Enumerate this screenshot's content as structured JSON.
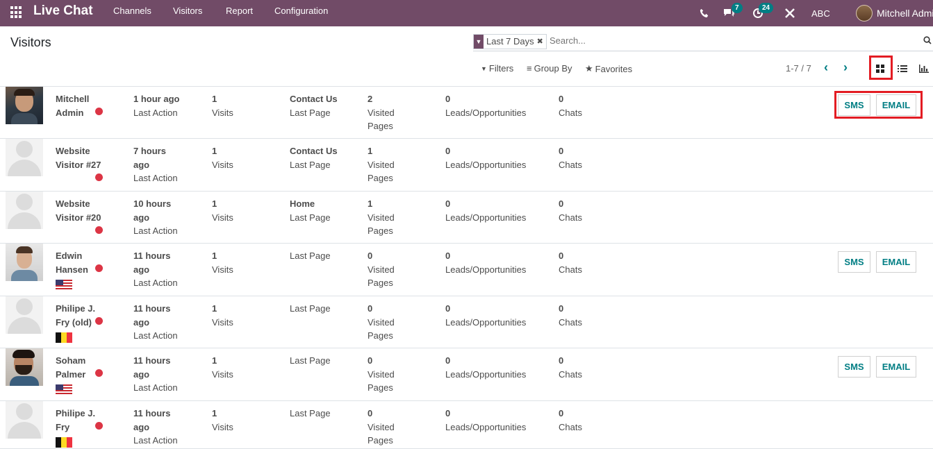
{
  "navbar": {
    "brand": "Live Chat",
    "menu": [
      "Channels",
      "Visitors",
      "Report",
      "Configuration"
    ],
    "messages_count": "7",
    "activities_count": "24",
    "company": "ABC",
    "user": "Mitchell Admi",
    "bg_color": "#714B67"
  },
  "control": {
    "title": "Visitors",
    "facet": "Last 7 Days",
    "search_placeholder": "Search...",
    "filters": "Filters",
    "group_by": "Group By",
    "favorites": "Favorites",
    "pager": "1-7 / 7"
  },
  "visitors": [
    {
      "name1": "Mitchell",
      "name2": "Admin",
      "time1": "1 hour ago",
      "time2": "",
      "visits": "1",
      "last_page": "Contact Us",
      "visited_pages": "2",
      "leads": "0",
      "chats": "0",
      "flag": "",
      "photo": "mitchell",
      "actions": true
    },
    {
      "name1": "Website",
      "name2": "Visitor #27",
      "time1": "7 hours",
      "time2": "ago",
      "visits": "1",
      "last_page": "Contact Us",
      "visited_pages": "1",
      "leads": "0",
      "chats": "0",
      "flag": "",
      "photo": "placeholder",
      "actions": false
    },
    {
      "name1": "Website",
      "name2": "Visitor #20",
      "time1": "10 hours",
      "time2": "ago",
      "visits": "1",
      "last_page": "Home",
      "visited_pages": "1",
      "leads": "0",
      "chats": "0",
      "flag": "",
      "photo": "placeholder",
      "actions": false
    },
    {
      "name1": "Edwin",
      "name2": "Hansen",
      "time1": "11 hours",
      "time2": "ago",
      "visits": "1",
      "last_page": "",
      "visited_pages": "0",
      "leads": "0",
      "chats": "0",
      "flag": "us",
      "photo": "edwin",
      "actions": true
    },
    {
      "name1": "Philipe J.",
      "name2": "Fry (old)",
      "time1": "11 hours",
      "time2": "ago",
      "visits": "1",
      "last_page": "",
      "visited_pages": "0",
      "leads": "0",
      "chats": "0",
      "flag": "be",
      "photo": "placeholder",
      "actions": false
    },
    {
      "name1": "Soham",
      "name2": "Palmer",
      "time1": "11 hours",
      "time2": "ago",
      "visits": "1",
      "last_page": "",
      "visited_pages": "0",
      "leads": "0",
      "chats": "0",
      "flag": "us",
      "photo": "soham",
      "actions": true
    },
    {
      "name1": "Philipe J.",
      "name2": "Fry",
      "time1": "11 hours",
      "time2": "ago",
      "visits": "1",
      "last_page": "",
      "visited_pages": "0",
      "leads": "0",
      "chats": "0",
      "flag": "be",
      "photo": "placeholder",
      "actions": false
    }
  ],
  "labels": {
    "last_action": "Last Action",
    "visits": "Visits",
    "last_page": "Last Page",
    "visited": "Visited",
    "pages": "Pages",
    "leads": "Leads/Opportunities",
    "chats": "Chats",
    "sms": "SMS",
    "email": "EMAIL"
  },
  "colors": {
    "accent": "#017e84",
    "status_dot": "#dc3545",
    "highlight": "#e31c23"
  }
}
